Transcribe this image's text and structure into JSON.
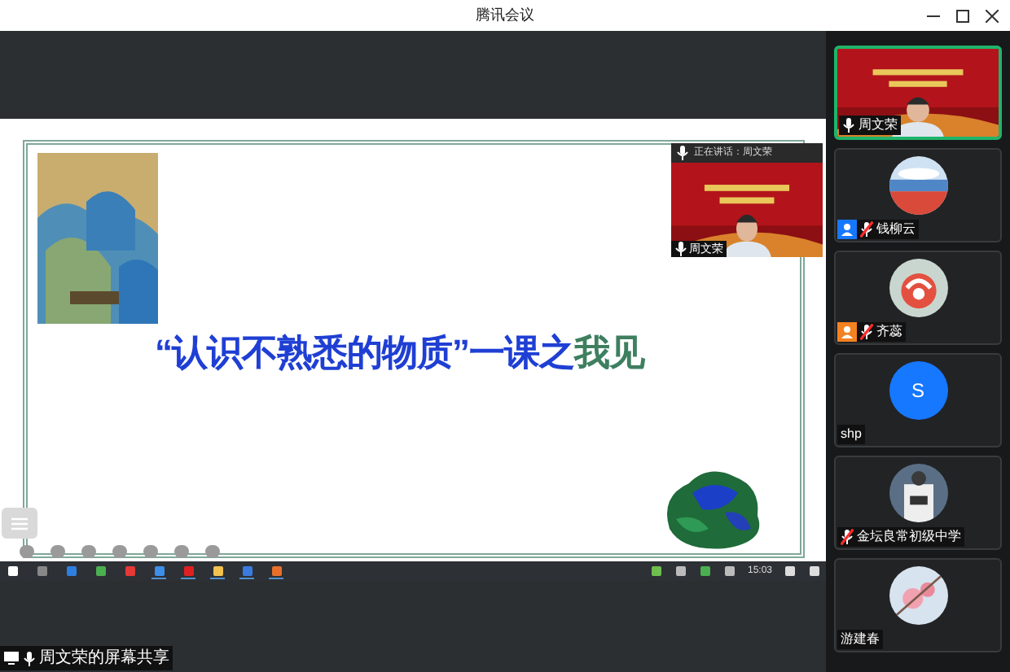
{
  "window": {
    "title": "腾讯会议"
  },
  "slide": {
    "title_parts": [
      {
        "text": "“认识不熟悉的物质”一课之",
        "color": "#1f3fd4"
      },
      {
        "text": "我见",
        "color": "#3e7f60"
      }
    ]
  },
  "floating_video": {
    "header": "正在讲话：周文荣",
    "name": "周文荣"
  },
  "taskbar": {
    "clock": "15:03"
  },
  "share_label": "周文荣的屏幕共享",
  "participants": [
    {
      "kind": "video",
      "name": "周文荣",
      "mic_icon": true,
      "muted": false,
      "active": true
    },
    {
      "kind": "avatar",
      "name": "钱柳云",
      "mic_icon": true,
      "muted": true,
      "color": "#1677ff",
      "active": false
    },
    {
      "kind": "avatar",
      "name": "齐蕊",
      "mic_icon": true,
      "muted": true,
      "color": "#f58220",
      "active": false
    },
    {
      "kind": "letter",
      "letter": "S",
      "name": "shp",
      "mic_icon": false,
      "active": false
    },
    {
      "kind": "avatar",
      "name": "金坛良常初级中学",
      "mic_icon": true,
      "muted": true,
      "active": false
    },
    {
      "kind": "avatar",
      "name": "游建春",
      "mic_icon": false,
      "active": false
    }
  ]
}
